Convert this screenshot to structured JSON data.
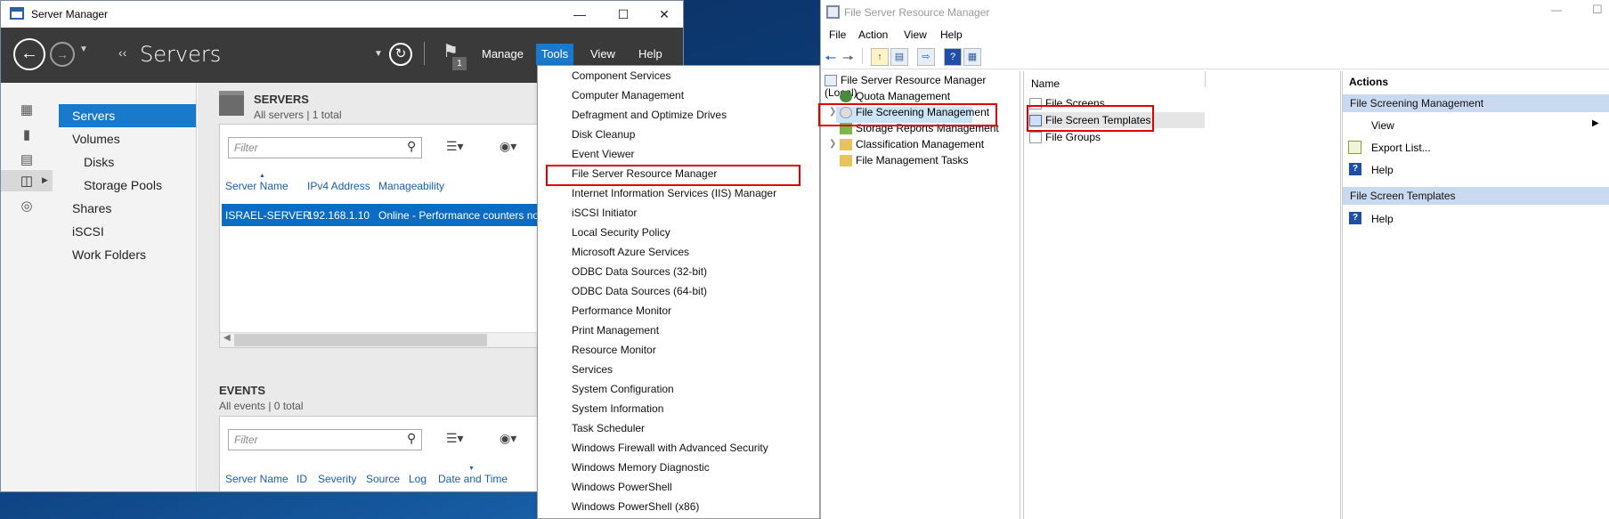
{
  "server_manager": {
    "title": "Server Manager",
    "breadcrumb": "Servers",
    "notification_count": "1",
    "menu": {
      "manage": "Manage",
      "tools": "Tools",
      "view": "View",
      "help": "Help"
    },
    "nav": {
      "items": [
        {
          "label": "Servers"
        },
        {
          "label": "Volumes"
        },
        {
          "label": "Disks"
        },
        {
          "label": "Storage Pools"
        },
        {
          "label": "Shares"
        },
        {
          "label": "iSCSI"
        },
        {
          "label": "Work Folders"
        }
      ]
    },
    "servers_tile": {
      "heading": "SERVERS",
      "subheading": "All servers | 1 total",
      "filter_placeholder": "Filter",
      "columns": [
        "Server Name",
        "IPv4 Address",
        "Manageability"
      ],
      "rows": [
        {
          "server_name": "ISRAEL-SERVER",
          "ipv4": "192.168.1.10",
          "manageability": "Online - Performance counters not"
        }
      ]
    },
    "events_tile": {
      "heading": "EVENTS",
      "subheading": "All events | 0 total",
      "filter_placeholder": "Filter",
      "columns": [
        "Server Name",
        "ID",
        "Severity",
        "Source",
        "Log",
        "Date and Time"
      ]
    }
  },
  "tools_menu": {
    "items": [
      "Component Services",
      "Computer Management",
      "Defragment and Optimize Drives",
      "Disk Cleanup",
      "Event Viewer",
      "File Server Resource Manager",
      "Internet Information Services (IIS) Manager",
      "iSCSI Initiator",
      "Local Security Policy",
      "Microsoft Azure Services",
      "ODBC Data Sources (32-bit)",
      "ODBC Data Sources (64-bit)",
      "Performance Monitor",
      "Print Management",
      "Resource Monitor",
      "Services",
      "System Configuration",
      "System Information",
      "Task Scheduler",
      "Windows Firewall with Advanced Security",
      "Windows Memory Diagnostic",
      "Windows PowerShell",
      "Windows PowerShell (x86)"
    ],
    "highlighted": "File Server Resource Manager"
  },
  "fsrm": {
    "title": "File Server Resource Manager",
    "menu": {
      "file": "File",
      "action": "Action",
      "view": "View",
      "help": "Help"
    },
    "tree": {
      "root": "File Server Resource Manager (Local)",
      "items": [
        "Quota Management",
        "File Screening Management",
        "Storage Reports Management",
        "Classification Management",
        "File Management Tasks"
      ]
    },
    "list": {
      "column": "Name",
      "items": [
        "File Screens",
        "File Screen Templates",
        "File Groups"
      ]
    },
    "actions": {
      "header": "Actions",
      "section1": {
        "title": "File Screening Management",
        "items": [
          "View",
          "Export List...",
          "Help"
        ]
      },
      "section2": {
        "title": "File Screen Templates",
        "items": [
          "Help"
        ]
      }
    }
  },
  "colors": {
    "accent": "#1979ca",
    "highlight_box": "#e00000",
    "header_dark": "#3a3a3a"
  }
}
